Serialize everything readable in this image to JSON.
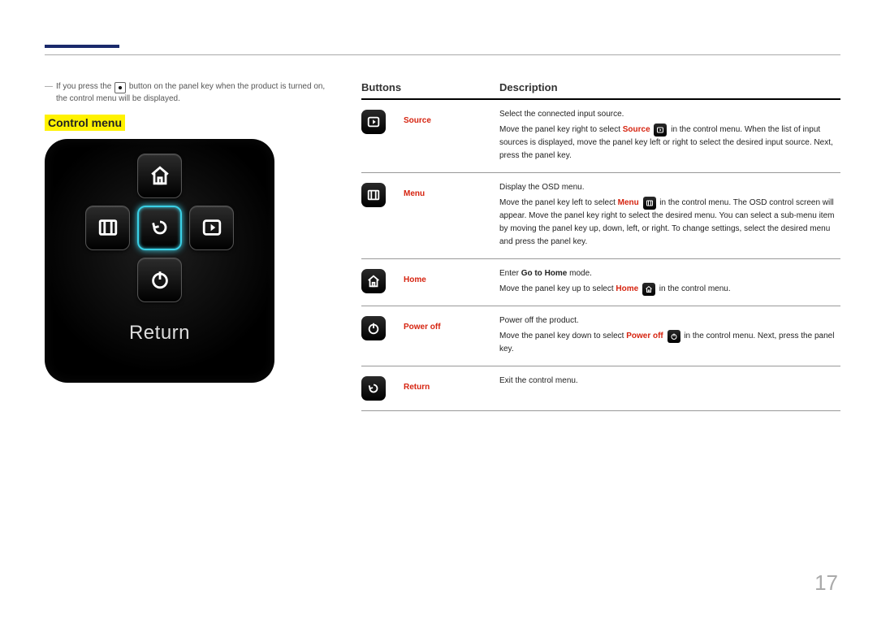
{
  "note": {
    "text_before": "If you press the ",
    "text_after": " button on the panel key when the product is turned on, the control menu will be displayed."
  },
  "control_menu_label": "Control menu",
  "panel_return_label": "Return",
  "table": {
    "header_buttons": "Buttons",
    "header_description": "Description",
    "rows": [
      {
        "icon": "source",
        "label": "Source",
        "lead": "Select the connected input source.",
        "body_parts": [
          "Move the panel key right to select ",
          "Source",
          " ",
          "ICON_SOURCE",
          " in the control menu. When the list of input sources is displayed, move the panel key left or right to select the desired input source. Next, press the panel key."
        ]
      },
      {
        "icon": "menu",
        "label": "Menu",
        "lead": "Display the OSD menu.",
        "body_parts": [
          "Move the panel key left to select ",
          "Menu",
          " ",
          "ICON_MENU",
          " in the control menu. The OSD control screen will appear. Move the panel key right to select the desired menu. You can select a sub-menu item by moving the panel key up, down, left, or right. To change settings, select the desired menu and press the panel key."
        ]
      },
      {
        "icon": "home",
        "label": "Home",
        "lead_parts": [
          "Enter ",
          "Go to Home",
          " mode."
        ],
        "body_parts": [
          "Move the panel key up to select ",
          "Home",
          " ",
          "ICON_HOME",
          " in the control menu."
        ]
      },
      {
        "icon": "power",
        "label": "Power off",
        "lead": "Power off the product.",
        "body_parts": [
          "Move the panel key down to select ",
          "Power off",
          " ",
          "ICON_POWER",
          " in the control menu. Next, press the panel key."
        ]
      },
      {
        "icon": "return",
        "label": "Return",
        "lead": "Exit the control menu.",
        "body_parts": []
      }
    ]
  },
  "page_number": "17"
}
